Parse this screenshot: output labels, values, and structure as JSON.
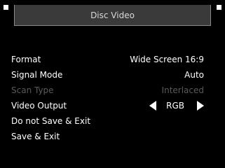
{
  "title": "Disc Video",
  "items": [
    {
      "label": "Format",
      "value": "Wide Screen 16:9"
    },
    {
      "label": "Signal Mode",
      "value": "Auto"
    },
    {
      "label": "Scan Type",
      "value": "Interlaced"
    },
    {
      "label": "Video Output",
      "value": "RGB"
    },
    {
      "label": "Do not Save & Exit"
    },
    {
      "label": "Save & Exit"
    }
  ]
}
